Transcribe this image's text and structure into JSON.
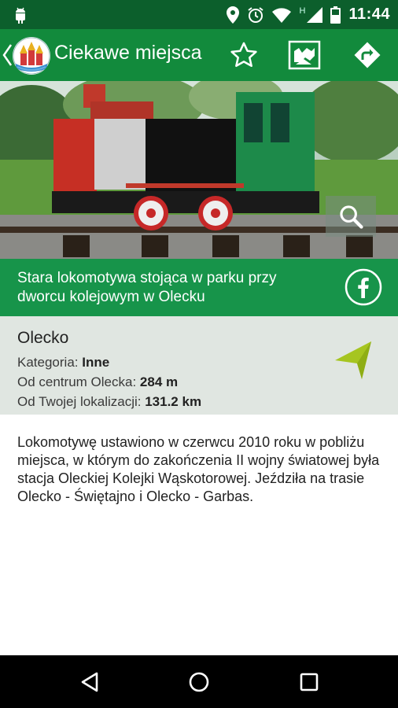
{
  "status_bar": {
    "time": "11:44",
    "icons": [
      "android-icon",
      "location-icon",
      "alarm-icon",
      "wifi-icon",
      "signal-icon",
      "battery-icon"
    ],
    "network_label": "H"
  },
  "toolbar": {
    "title": "Ciekawe miejsca",
    "icons": [
      "back-chevron-icon",
      "app-logo",
      "star-icon",
      "map-icon",
      "directions-icon"
    ]
  },
  "photo": {
    "zoom_icon": "magnifier-icon"
  },
  "caption": {
    "text": "Stara lokomotywa stojąca w parku przy dworcu kolejowym w Olecku",
    "share_icon": "facebook-icon"
  },
  "info": {
    "place_name": "Olecko",
    "category_label": "Kategoria:",
    "category_value": "Inne",
    "center_label": "Od centrum Olecka:",
    "center_value": "284 m",
    "location_label": "Od Twojej lokalizacji:",
    "location_value": "131.2 km",
    "navigate_icon": "navigation-arrow-icon"
  },
  "description": {
    "text": "Lokomotywę ustawiono w czerwcu 2010 roku w pobliżu miejsca, w którym do zakończenia II wojny światowej była stacja Oleckiej Kolejki Wąskotorowej. Jeździła na trasie Olecko - Świętajno i Olecko - Garbas."
  },
  "colors": {
    "status_bar": "#0c5f2c",
    "toolbar": "#128a3c",
    "caption": "#17944a",
    "info_bg": "#e0e6e1",
    "nav_arrow": "#a6c520"
  }
}
